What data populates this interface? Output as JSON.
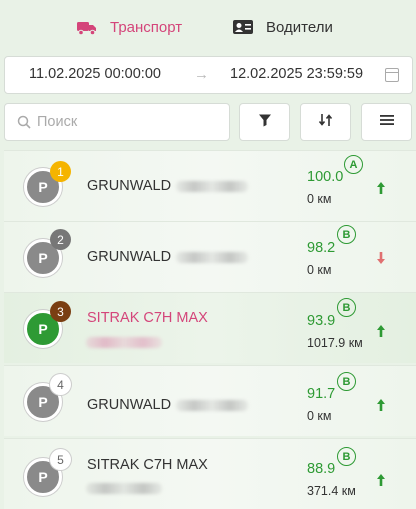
{
  "tabs": {
    "transport": "Транспорт",
    "drivers": "Водители"
  },
  "daterange": {
    "from": "11.02.2025 00:00:00",
    "to": "12.02.2025 23:59:59"
  },
  "search": {
    "placeholder": "Поиск",
    "value": ""
  },
  "icons": {
    "transport": "truck-icon",
    "drivers": "id-card-icon",
    "filter": "filter-icon",
    "sort": "sort-icon",
    "menu": "hamburger-menu-icon",
    "calendar": "calendar-icon",
    "search": "search-icon"
  },
  "colors": {
    "accent": "#d4457a",
    "positive": "#2e9a34",
    "negative": "#e07070",
    "rank1": "#f5b400",
    "rank2": "#777777",
    "rank3": "#7a3e12"
  },
  "vehicles": [
    {
      "rank": "1",
      "avatar": "P",
      "name": "GRUNWALD",
      "score": "100.0",
      "grade": "A",
      "distance": "0 км",
      "trend": "up"
    },
    {
      "rank": "2",
      "avatar": "P",
      "name": "GRUNWALD",
      "score": "98.2",
      "grade": "B",
      "distance": "0 км",
      "trend": "down"
    },
    {
      "rank": "3",
      "avatar": "P",
      "name": "SITRAK C7H MAX",
      "score": "93.9",
      "grade": "B",
      "distance": "1017.9 км",
      "trend": "up",
      "selected": true
    },
    {
      "rank": "4",
      "avatar": "P",
      "name": "GRUNWALD",
      "score": "91.7",
      "grade": "B",
      "distance": "0 км",
      "trend": "up"
    },
    {
      "rank": "5",
      "avatar": "P",
      "name": "SITRAK C7H MAX",
      "score": "88.9",
      "grade": "B",
      "distance": "371.4 км",
      "trend": "up"
    }
  ]
}
